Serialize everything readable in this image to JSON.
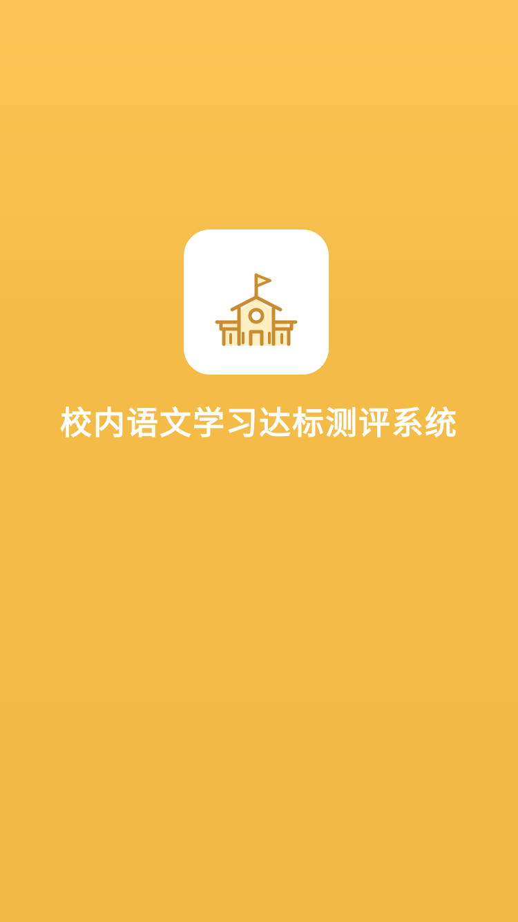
{
  "app": {
    "title": "校内语文学习达标测评系统",
    "icon": "school-building-icon"
  },
  "colors": {
    "background_top": "#fcc457",
    "background_bottom": "#f2bb45",
    "icon_tile": "#ffffff",
    "icon_stroke": "#c98d2f",
    "icon_fill": "#fdeec4"
  }
}
